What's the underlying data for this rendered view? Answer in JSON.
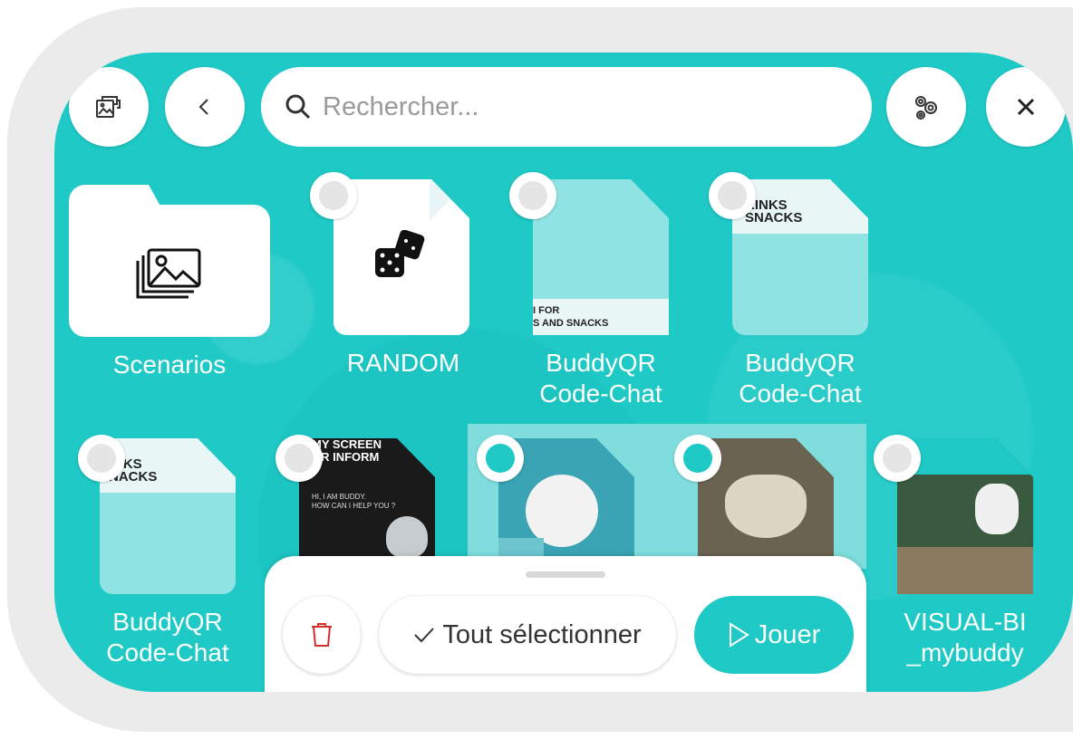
{
  "toolbar": {
    "search_placeholder": "Rechercher...",
    "icons": [
      "gallery-icon",
      "back-icon",
      "search-icon",
      "settings-icon",
      "close-icon"
    ]
  },
  "grid": {
    "items": [
      {
        "label": "Scenarios",
        "type": "folder"
      },
      {
        "label": "RANDOM",
        "type": "file",
        "icon": "dice-icon"
      },
      {
        "label": "BuddyQR\nCode-Chat",
        "type": "file",
        "thumb_text": "I FOR\nS AND SNACKS"
      },
      {
        "label": "BuddyQR\nCode-Chat",
        "type": "file",
        "thumb_text": "RINKS\nSNACKS"
      },
      {
        "label": "BuddyQR\nCode-Chat",
        "type": "file",
        "thumb_text": "RINKS\nSNACKS"
      },
      {
        "label": "",
        "type": "file",
        "thumb_text": "MY SCREEN\nOR INFORM",
        "thumb_sub": "HI, I AM BUDDY.\nHOW CAN I HELP YOU ?"
      },
      {
        "label": "",
        "type": "file",
        "selected": true
      },
      {
        "label": "",
        "type": "file",
        "selected": true
      },
      {
        "label": "VISUAL-BI\n_mybuddy",
        "type": "file"
      }
    ]
  },
  "bottom_sheet": {
    "select_all_label": "Tout sélectionner",
    "play_label": "Jouer"
  },
  "colors": {
    "accent": "#1ec9c6",
    "delete": "#d32f2f"
  }
}
